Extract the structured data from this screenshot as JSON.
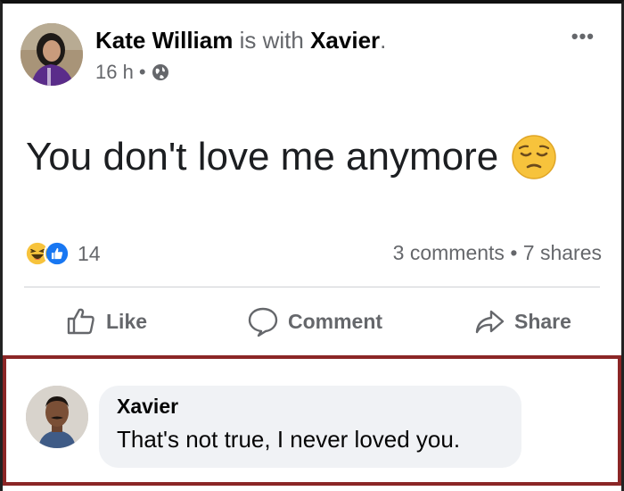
{
  "post": {
    "author": "Kate William",
    "with_text": "is with",
    "tagged": "Xavier",
    "period": ".",
    "time": "16 h",
    "separator": "•",
    "audience_icon": "globe-icon",
    "more_label": "•••",
    "text": "You don't love me anymore",
    "emoji": "pensive-face-emoji"
  },
  "reactions": {
    "icons": [
      "haha-reaction-icon",
      "like-reaction-icon"
    ],
    "count": "14",
    "comments": "3 comments",
    "shares": "7 shares",
    "separator": "•"
  },
  "actions": {
    "like": "Like",
    "comment": "Comment",
    "share": "Share"
  },
  "comment": {
    "author": "Xavier",
    "text": "That's not true, I never loved you."
  },
  "colors": {
    "highlight_border": "#8b2626",
    "secondary_text": "#65676b",
    "bubble_bg": "#f0f2f5",
    "like_blue": "#1877f2"
  }
}
